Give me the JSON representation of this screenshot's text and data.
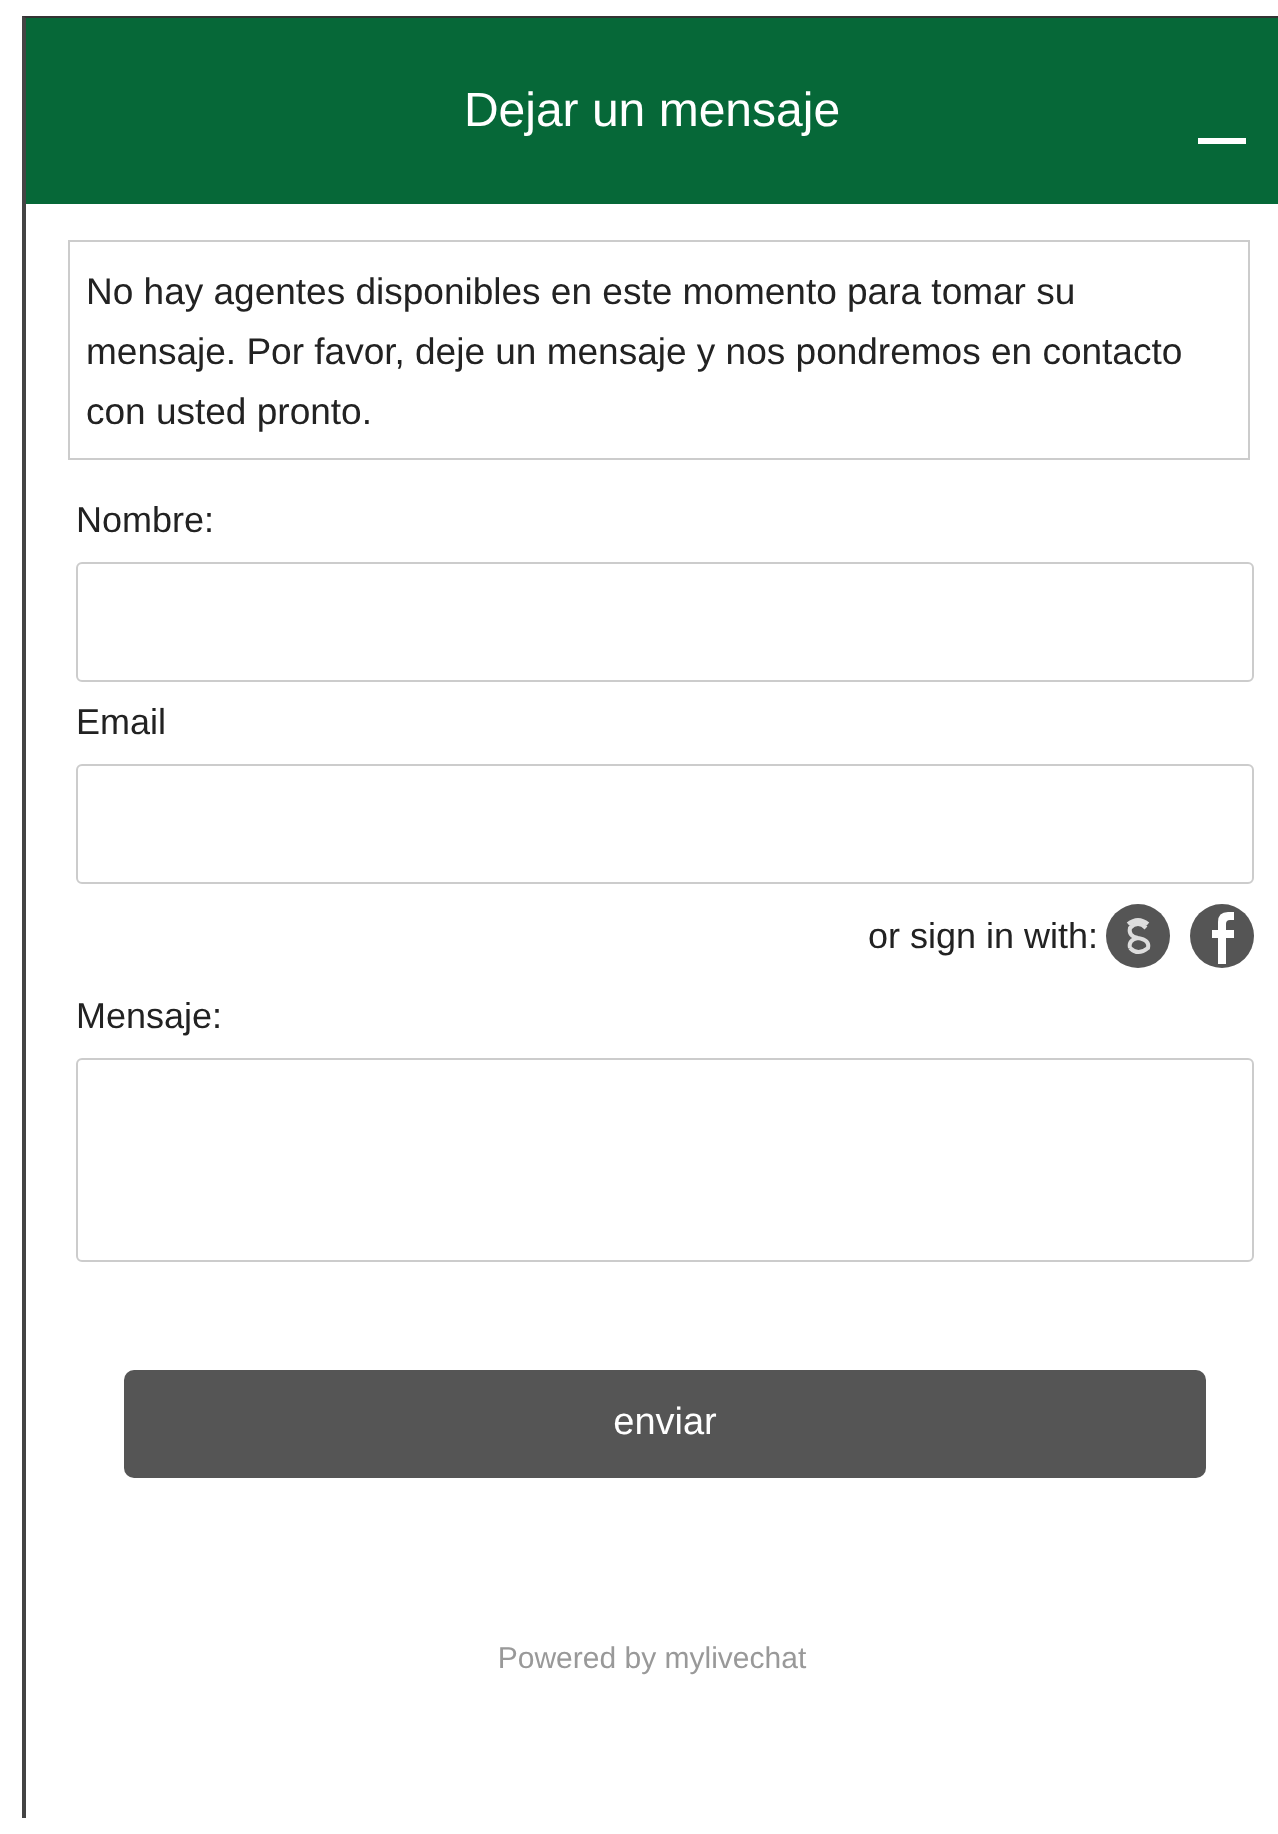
{
  "header": {
    "title": "Dejar un mensaje"
  },
  "notice": "No hay agentes disponibles en este momento para tomar su mensaje. Por favor, deje un mensaje y nos pondremos en contacto con usted pronto.",
  "fields": [
    {
      "kind": "input",
      "label": "Nombre:"
    },
    {
      "kind": "input",
      "label": "Email"
    },
    {
      "kind": "social",
      "text": "or sign in with:"
    },
    {
      "kind": "textarea",
      "label": "Mensaje:"
    }
  ],
  "submit": "enviar",
  "footer": "Powered by mylivechat"
}
